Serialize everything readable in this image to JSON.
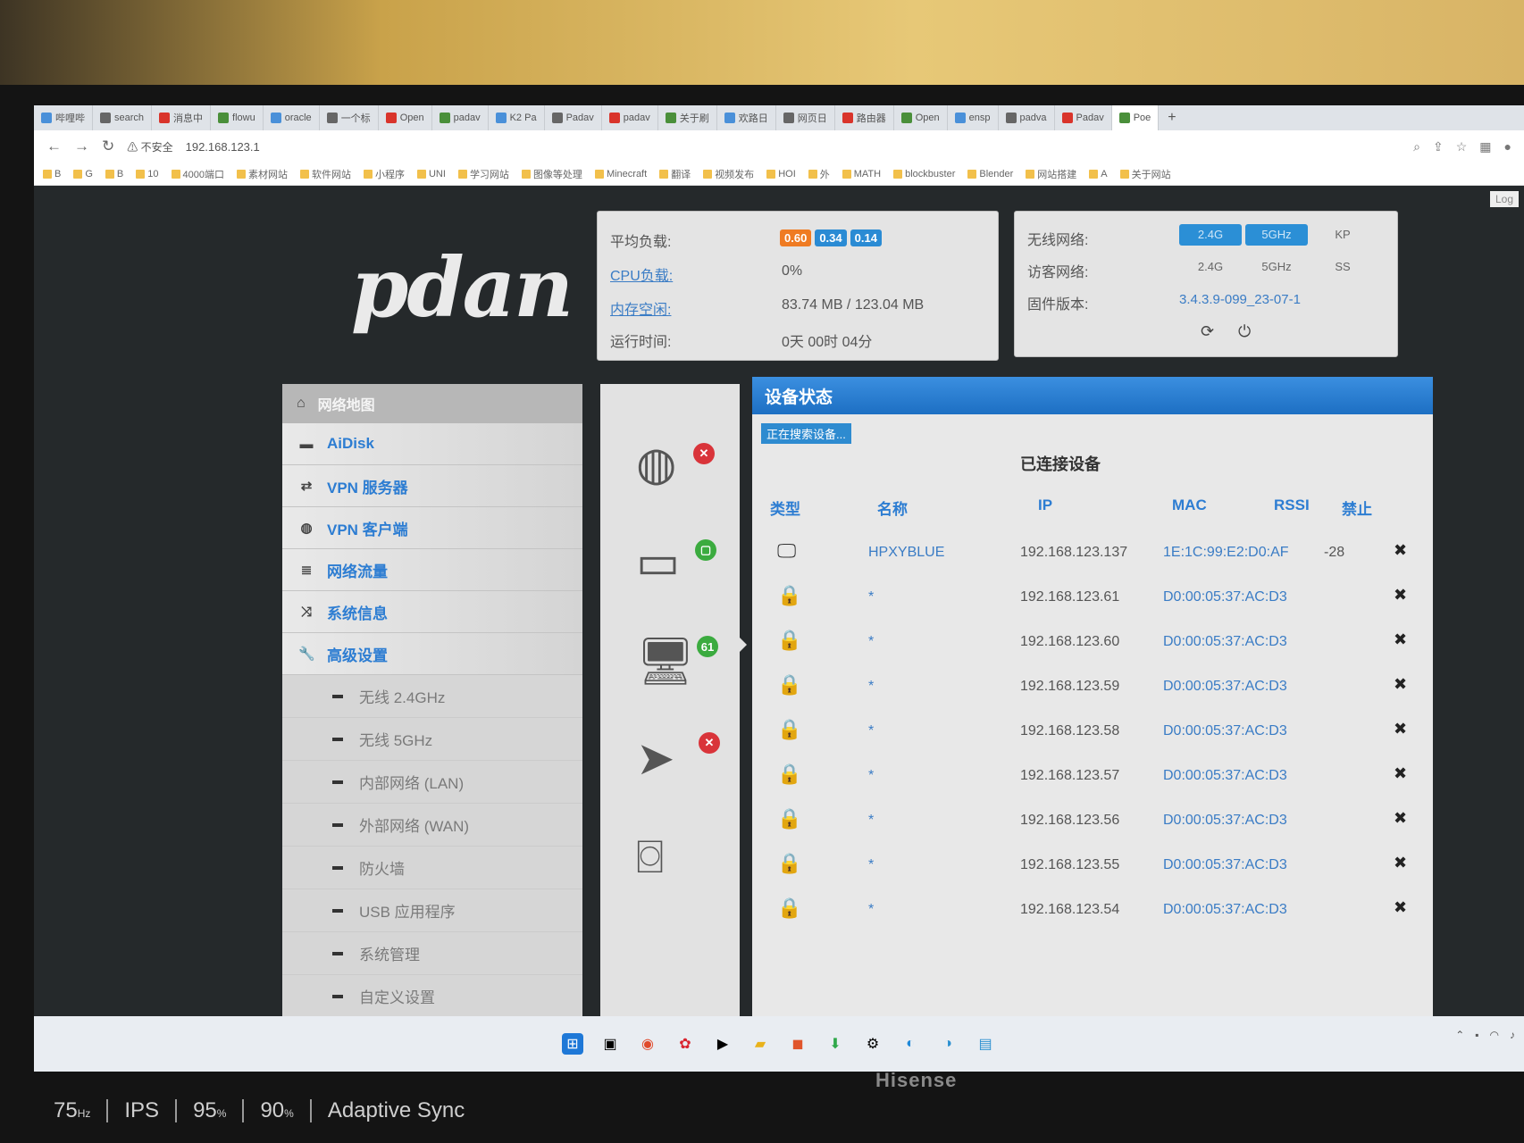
{
  "browser": {
    "tabs": [
      "哔哩哔",
      "search",
      "消息中",
      "flowu",
      "oracle",
      "一个标",
      "Open",
      "padav",
      "K2 Pa",
      "Padav",
      "padav",
      "关于刷",
      "欢路日",
      "网页日",
      "路由器",
      "Open",
      "ensp",
      "padva",
      "Padav",
      "Poe"
    ],
    "insecure_label": "不安全",
    "url": "192.168.123.1",
    "bookmarks": [
      "B",
      "G",
      "B",
      "10",
      "4000端口",
      "素材网站",
      "软件网站",
      "小程序",
      "UNI",
      "学习网站",
      "图像等处理",
      "Minecraft",
      "翻译",
      "视频发布",
      "HOI",
      "外",
      "MATH",
      "blockbuster",
      "Blender",
      "网站搭建",
      "A",
      "关于网站"
    ]
  },
  "page": {
    "log_label": "Log",
    "logo_text": "pdan",
    "status": {
      "load_label": "平均负载:",
      "load_values": [
        "0.60",
        "0.34",
        "0.14"
      ],
      "load_colors": [
        "#ef7b22",
        "#2a8bd4",
        "#2a8bd4"
      ],
      "cpu_label": "CPU负载:",
      "cpu_value": "0%",
      "mem_label": "内存空闲:",
      "mem_value": "83.74 MB / 123.04 MB",
      "uptime_label": "运行时间:",
      "uptime_value": "0天 00时 04分"
    },
    "wifi": {
      "wireless_label": "无线网络:",
      "wireless_buttons": [
        "2.4G",
        "5GHz",
        "KP"
      ],
      "guest_label": "访客网络:",
      "guest_buttons": [
        "2.4G",
        "5GHz",
        "SS"
      ],
      "firmware_label": "固件版本:",
      "firmware_value": "3.4.3.9-099_23-07-1",
      "refresh_icon": "refresh-icon",
      "power_icon": "power-icon"
    },
    "menu": {
      "header": "网络地图",
      "items": [
        {
          "icon": "disk-icon",
          "label": "AiDisk"
        },
        {
          "icon": "vpn-server-icon",
          "label": "VPN 服务器"
        },
        {
          "icon": "globe-icon",
          "label": "VPN 客户端"
        },
        {
          "icon": "traffic-icon",
          "label": "网络流量"
        },
        {
          "icon": "shuffle-icon",
          "label": "系统信息"
        },
        {
          "icon": "wrench-icon",
          "label": "高级设置"
        }
      ],
      "subitems": [
        "无线 2.4GHz",
        "无线 5GHz",
        "内部网络 (LAN)",
        "外部网络 (WAN)",
        "防火墙",
        "USB 应用程序",
        "系统管理",
        "自定义设置"
      ]
    },
    "icons": {
      "clients_count": "61"
    },
    "devices": {
      "title": "设备状态",
      "scanning_label": "正在搜索设备...",
      "connected_title": "已连接设备",
      "columns": [
        "类型",
        "名称",
        "IP",
        "MAC",
        "RSSI",
        "禁止"
      ],
      "rows": [
        {
          "name": "HPXYBLUE",
          "ip": "192.168.123.137",
          "mac": "1E:1C:99:E2:D0:AF",
          "rssi": "-28"
        },
        {
          "name": "*",
          "ip": "192.168.123.61",
          "mac": "D0:00:05:37:AC:D3",
          "rssi": ""
        },
        {
          "name": "*",
          "ip": "192.168.123.60",
          "mac": "D0:00:05:37:AC:D3",
          "rssi": ""
        },
        {
          "name": "*",
          "ip": "192.168.123.59",
          "mac": "D0:00:05:37:AC:D3",
          "rssi": ""
        },
        {
          "name": "*",
          "ip": "192.168.123.58",
          "mac": "D0:00:05:37:AC:D3",
          "rssi": ""
        },
        {
          "name": "*",
          "ip": "192.168.123.57",
          "mac": "D0:00:05:37:AC:D3",
          "rssi": ""
        },
        {
          "name": "*",
          "ip": "192.168.123.56",
          "mac": "D0:00:05:37:AC:D3",
          "rssi": ""
        },
        {
          "name": "*",
          "ip": "192.168.123.55",
          "mac": "D0:00:05:37:AC:D3",
          "rssi": ""
        },
        {
          "name": "*",
          "ip": "192.168.123.54",
          "mac": "D0:00:05:37:AC:D3",
          "rssi": ""
        }
      ]
    }
  },
  "monitor": {
    "brand": "Hisense",
    "osd": [
      {
        "value": "75",
        "unit": "Hz"
      },
      {
        "value": "IPS",
        "unit": ""
      },
      {
        "value": "95",
        "unit": "%"
      },
      {
        "value": "90",
        "unit": "%"
      },
      {
        "value": "Adaptive Sync",
        "unit": ""
      }
    ]
  }
}
